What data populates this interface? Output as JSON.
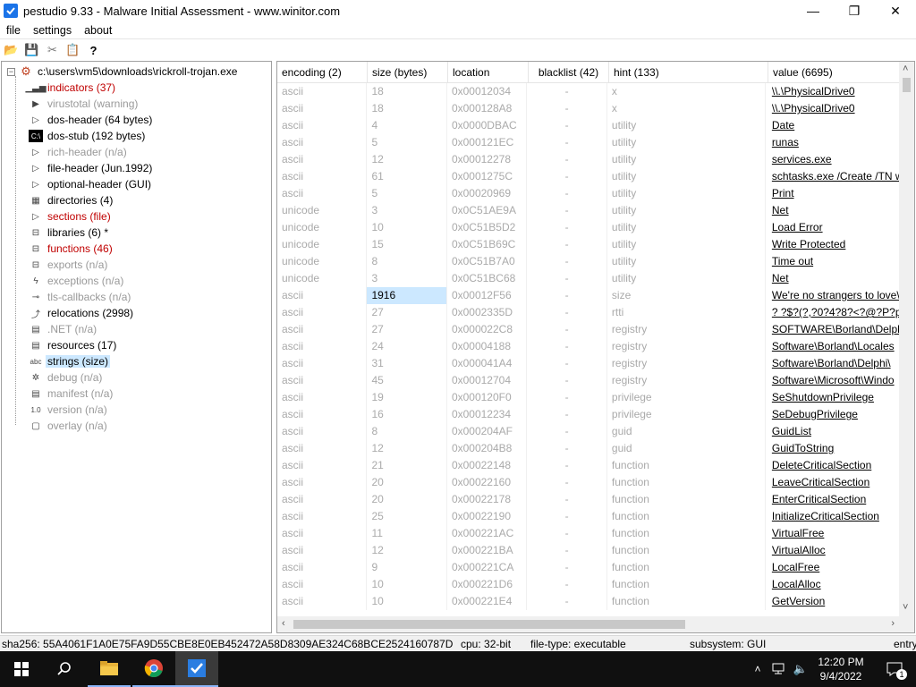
{
  "window": {
    "title": "pestudio 9.33 - Malware Initial Assessment - www.winitor.com",
    "minimize": "—",
    "maximize": "❐",
    "close": "✕"
  },
  "menu": [
    "file",
    "settings",
    "about"
  ],
  "toolbar": [
    {
      "icon": "open-folder-icon",
      "glyph": "📂"
    },
    {
      "icon": "save-icon",
      "glyph": "💾"
    },
    {
      "icon": "cut-icon",
      "glyph": "✂"
    },
    {
      "icon": "clipboard-icon",
      "glyph": "📋"
    },
    {
      "icon": "help-icon",
      "glyph": "?"
    }
  ],
  "tree": {
    "root": "c:\\users\\vm5\\downloads\\rickroll-trojan.exe",
    "items": [
      {
        "label": "indicators (37)",
        "style": "red",
        "icon": "bar-chart-icon",
        "glyph": "▁▃▅"
      },
      {
        "label": "virustotal (warning)",
        "style": "gray",
        "icon": "virustotal-icon",
        "glyph": "▶"
      },
      {
        "label": "dos-header (64 bytes)",
        "style": "normal",
        "icon": "chevron-right-icon",
        "glyph": "▷"
      },
      {
        "label": "dos-stub (192 bytes)",
        "style": "normal",
        "icon": "terminal-icon",
        "glyph": "C:\\"
      },
      {
        "label": "rich-header (n/a)",
        "style": "gray",
        "icon": "chevron-right-icon",
        "glyph": "▷"
      },
      {
        "label": "file-header (Jun.1992)",
        "style": "normal",
        "icon": "chevron-right-icon",
        "glyph": "▷"
      },
      {
        "label": "optional-header (GUI)",
        "style": "normal",
        "icon": "chevron-right-icon",
        "glyph": "▷"
      },
      {
        "label": "directories (4)",
        "style": "normal",
        "icon": "directories-icon",
        "glyph": "▦"
      },
      {
        "label": "sections (file)",
        "style": "red",
        "icon": "chevron-right-icon",
        "glyph": "▷"
      },
      {
        "label": "libraries (6) *",
        "style": "normal",
        "icon": "libraries-icon",
        "glyph": "⊟"
      },
      {
        "label": "functions (46)",
        "style": "red",
        "icon": "functions-icon",
        "glyph": "⊟"
      },
      {
        "label": "exports (n/a)",
        "style": "gray",
        "icon": "exports-icon",
        "glyph": "⊟"
      },
      {
        "label": "exceptions (n/a)",
        "style": "gray",
        "icon": "lightning-icon",
        "glyph": "ϟ"
      },
      {
        "label": "tls-callbacks (n/a)",
        "style": "gray",
        "icon": "callback-icon",
        "glyph": "⊸"
      },
      {
        "label": "relocations (2998)",
        "style": "normal",
        "icon": "relocation-icon",
        "glyph": "⤴"
      },
      {
        "label": ".NET (n/a)",
        "style": "gray",
        "icon": "dotnet-icon",
        "glyph": "▤"
      },
      {
        "label": "resources (17)",
        "style": "normal",
        "icon": "resources-icon",
        "glyph": "▤"
      },
      {
        "label": "strings (size)",
        "style": "selected",
        "icon": "strings-icon",
        "glyph": "abc"
      },
      {
        "label": "debug (n/a)",
        "style": "gray",
        "icon": "bug-icon",
        "glyph": "✲"
      },
      {
        "label": "manifest (n/a)",
        "style": "gray",
        "icon": "manifest-icon",
        "glyph": "▤"
      },
      {
        "label": "version (n/a)",
        "style": "gray",
        "icon": "version-icon",
        "glyph": "1.0"
      },
      {
        "label": "overlay (n/a)",
        "style": "gray",
        "icon": "overlay-icon",
        "glyph": "▢"
      }
    ]
  },
  "table": {
    "headers": [
      "encoding (2)",
      "size (bytes)",
      "location",
      "blacklist (42)",
      "hint (133)",
      "value (6695)"
    ],
    "rows": [
      [
        "ascii",
        "18",
        "0x00012034",
        "-",
        "x",
        "\\\\.\\PhysicalDrive0"
      ],
      [
        "ascii",
        "18",
        "0x000128A8",
        "-",
        "x",
        "\\\\.\\PhysicalDrive0"
      ],
      [
        "ascii",
        "4",
        "0x0000DBAC",
        "-",
        "utility",
        "Date"
      ],
      [
        "ascii",
        "5",
        "0x000121EC",
        "-",
        "utility",
        "runas"
      ],
      [
        "ascii",
        "12",
        "0x00012278",
        "-",
        "utility",
        "services.exe"
      ],
      [
        "ascii",
        "61",
        "0x0001275C",
        "-",
        "utility",
        "schtasks.exe /Create /TN w"
      ],
      [
        "ascii",
        "5",
        "0x00020969",
        "-",
        "utility",
        "Print"
      ],
      [
        "unicode",
        "3",
        "0x0C51AE9A",
        "-",
        "utility",
        "Net"
      ],
      [
        "unicode",
        "10",
        "0x0C51B5D2",
        "-",
        "utility",
        "Load Error"
      ],
      [
        "unicode",
        "15",
        "0x0C51B69C",
        "-",
        "utility",
        "Write Protected"
      ],
      [
        "unicode",
        "8",
        "0x0C51B7A0",
        "-",
        "utility",
        "Time out"
      ],
      [
        "unicode",
        "3",
        "0x0C51BC68",
        "-",
        "utility",
        "Net"
      ],
      [
        "ascii",
        "1916",
        "0x00012F56",
        "-",
        "size",
        "We're no strangers to love\\"
      ],
      [
        "ascii",
        "27",
        "0x0002335D",
        "-",
        "rtti",
        "? ?$?(?,?0?4?8?<?@?P?p?x?|"
      ],
      [
        "ascii",
        "27",
        "0x000022C8",
        "-",
        "registry",
        "SOFTWARE\\Borland\\Delphi"
      ],
      [
        "ascii",
        "24",
        "0x00004188",
        "-",
        "registry",
        "Software\\Borland\\Locales"
      ],
      [
        "ascii",
        "31",
        "0x000041A4",
        "-",
        "registry",
        "Software\\Borland\\Delphi\\"
      ],
      [
        "ascii",
        "45",
        "0x00012704",
        "-",
        "registry",
        "Software\\Microsoft\\Windo"
      ],
      [
        "ascii",
        "19",
        "0x000120F0",
        "-",
        "privilege",
        "SeShutdownPrivilege"
      ],
      [
        "ascii",
        "16",
        "0x00012234",
        "-",
        "privilege",
        "SeDebugPrivilege"
      ],
      [
        "ascii",
        "8",
        "0x000204AF",
        "-",
        "guid",
        "GuidList"
      ],
      [
        "ascii",
        "12",
        "0x000204B8",
        "-",
        "guid",
        "GuidToString"
      ],
      [
        "ascii",
        "21",
        "0x00022148",
        "-",
        "function",
        "DeleteCriticalSection"
      ],
      [
        "ascii",
        "20",
        "0x00022160",
        "-",
        "function",
        "LeaveCriticalSection"
      ],
      [
        "ascii",
        "20",
        "0x00022178",
        "-",
        "function",
        "EnterCriticalSection"
      ],
      [
        "ascii",
        "25",
        "0x00022190",
        "-",
        "function",
        "InitializeCriticalSection"
      ],
      [
        "ascii",
        "11",
        "0x000221AC",
        "-",
        "function",
        "VirtualFree"
      ],
      [
        "ascii",
        "12",
        "0x000221BA",
        "-",
        "function",
        "VirtualAlloc"
      ],
      [
        "ascii",
        "9",
        "0x000221CA",
        "-",
        "function",
        "LocalFree"
      ],
      [
        "ascii",
        "10",
        "0x000221D6",
        "-",
        "function",
        "LocalAlloc"
      ],
      [
        "ascii",
        "10",
        "0x000221E4",
        "-",
        "function",
        "GetVersion"
      ]
    ]
  },
  "status": {
    "sha256": "sha256: 55A4061F1A0E75FA9D55CBE8E0EB452472A58D8309AE324C68BCE2524160787D",
    "cpu": "cpu: 32-bit",
    "filetype": "file-type: executable",
    "subsystem": "subsystem: GUI",
    "entry": "entry"
  },
  "taskbar": {
    "time": "12:20 PM",
    "date": "9/4/2022",
    "notifications": "1"
  },
  "colors": {
    "red": "#c00000",
    "gray": "#999999",
    "selection": "#cce8ff",
    "taskbar": "#101010"
  }
}
